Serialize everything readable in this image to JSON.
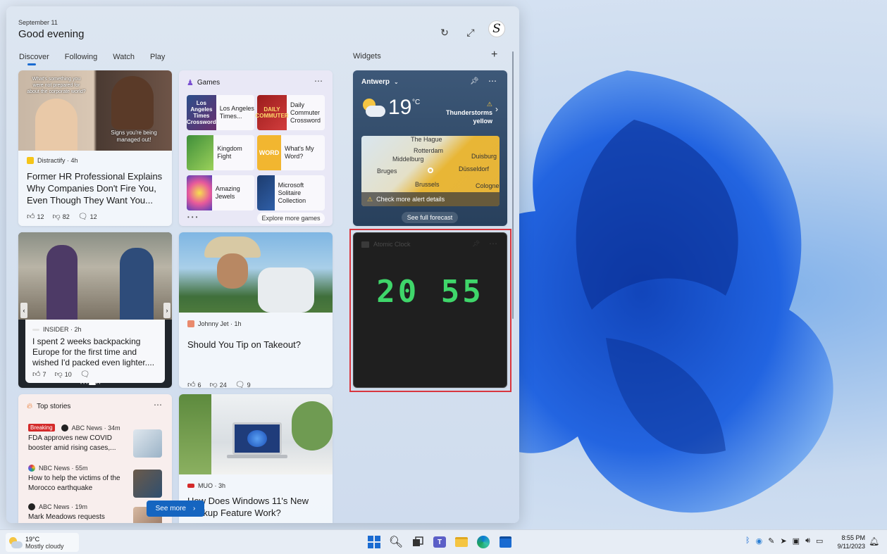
{
  "header": {
    "date": "September 11",
    "greeting": "Good evening",
    "avatar_initial": "S"
  },
  "tabs": [
    {
      "label": "Discover"
    },
    {
      "label": "Following"
    },
    {
      "label": "Watch"
    },
    {
      "label": "Play"
    }
  ],
  "widgets": {
    "title": "Widgets",
    "add_label": "+"
  },
  "news1": {
    "overlay_top": "What's something you were not prepared for about the corporate world?",
    "overlay_bottom": "Signs you're being managed out!",
    "source": "Distractify · 4h",
    "headline": "Former HR Professional Explains Why Companies Don't Fire You, Even Though They Want You...",
    "likes": "12",
    "dislikes": "82",
    "comments": "12"
  },
  "games": {
    "title": "Games",
    "items": [
      {
        "name": "Los Angeles Times...",
        "thumb": "Los Angeles Times Crossword"
      },
      {
        "name": "Daily Commuter Crossword",
        "thumb": "DAILY COMMUTER"
      },
      {
        "name": "Kingdom Fight",
        "thumb": ""
      },
      {
        "name": "What's My Word?",
        "thumb": "WORD"
      },
      {
        "name": "Amazing Jewels",
        "thumb": ""
      },
      {
        "name": "Microsoft Solitaire Collection",
        "thumb": ""
      }
    ],
    "explore": "Explore more games"
  },
  "weather": {
    "city": "Antwerp",
    "temp": "19",
    "unit": "°C",
    "alert_line1": "Thunderstorms",
    "alert_line2": "yellow",
    "map_labels": [
      "The Hague",
      "Rotterdam",
      "Middelburg",
      "Duisburg",
      "Bruges",
      "Düsseldorf",
      "Brussels",
      "Cologne"
    ],
    "map_alert": "Check more alert details",
    "forecast": "See full forecast"
  },
  "clock": {
    "title": "Atomic Clock",
    "time": "20 55"
  },
  "news2": {
    "source": "INSIDER · 2h",
    "headline": "I spent 2 weeks backpacking Europe for the first time and wished I'd packed even lighter....",
    "likes": "7",
    "dislikes": "10"
  },
  "news3": {
    "source": "Johnny Jet · 1h",
    "headline": "Should You Tip on Takeout?",
    "likes": "6",
    "dislikes": "24",
    "comments": "9"
  },
  "top_stories": {
    "title": "Top stories",
    "items": [
      {
        "badge": "Breaking",
        "source": "ABC News · 34m",
        "headline": "FDA approves new COVID booster amid rising cases,..."
      },
      {
        "badge": "",
        "source": "NBC News · 55m",
        "headline": "How to help the victims of the Morocco earthquake"
      },
      {
        "badge": "",
        "source": "ABC News · 19m",
        "headline": "Mark Meadows requests"
      }
    ]
  },
  "news4": {
    "source": "MUO · 3h",
    "headline": "How Does Windows 11's New Backup Feature Work?"
  },
  "see_more": "See more",
  "taskbar": {
    "weather_temp": "19°C",
    "weather_desc": "Mostly cloudy",
    "time": "8:55 PM",
    "date": "9/11/2023"
  },
  "colors": {
    "accent": "#1a6bd1",
    "clock_digits": "#3fd66a",
    "highlight": "#d9363e",
    "breaking": "#d42a2a"
  }
}
